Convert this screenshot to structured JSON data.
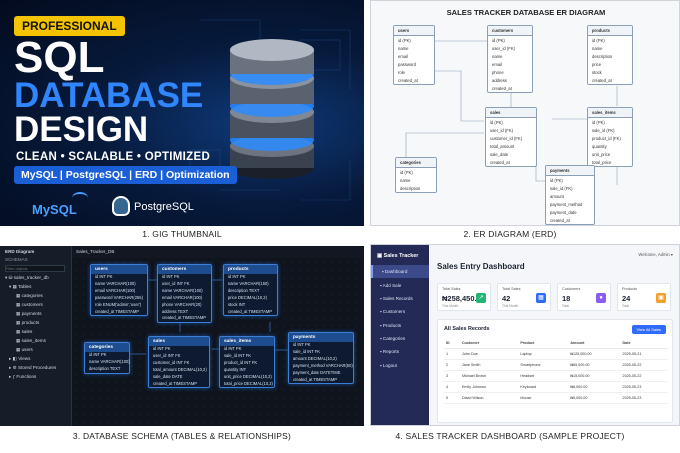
{
  "captions": [
    "1. GIG THUMBNAIL",
    "2. ER DIAGRAM (ERD)",
    "3. DATABASE SCHEMA (TABLES & RELATIONSHIPS)",
    "4. SALES TRACKER DASHBOARD (SAMPLE PROJECT)"
  ],
  "thumb": {
    "badge": "PROFESSIONAL",
    "line1": "SQL",
    "line2": "DATABASE",
    "line3": "DESIGN",
    "tagline": "CLEAN • SCALABLE • OPTIMIZED",
    "tech": "MySQL | PostgreSQL | ERD | Optimization",
    "mysql": "MySQL",
    "postgres": "PostgreSQL"
  },
  "erd": {
    "title": "SALES TRACKER DATABASE ER DIAGRAM",
    "users": {
      "name": "users",
      "fields": [
        "id (PK)",
        "name",
        "email",
        "password",
        "role",
        "created_at"
      ]
    },
    "customers": {
      "name": "customers",
      "fields": [
        "id (PK)",
        "user_id (FK)",
        "name",
        "email",
        "phone",
        "address",
        "created_at"
      ]
    },
    "products": {
      "name": "products",
      "fields": [
        "id (PK)",
        "name",
        "description",
        "price",
        "stock",
        "created_at"
      ]
    },
    "sales": {
      "name": "sales",
      "fields": [
        "id (PK)",
        "user_id (FK)",
        "customer_id (FK)",
        "total_amount",
        "sale_date",
        "created_at"
      ]
    },
    "sales_items": {
      "name": "sales_items",
      "fields": [
        "id (PK)",
        "sale_id (FK)",
        "product_id (FK)",
        "quantity",
        "unit_price",
        "total_price"
      ]
    },
    "categories": {
      "name": "categories",
      "fields": [
        "id (PK)",
        "name",
        "description"
      ]
    },
    "payments": {
      "name": "payments",
      "fields": [
        "id (PK)",
        "sale_id (FK)",
        "amount",
        "payment_method",
        "payment_date",
        "created_at"
      ]
    }
  },
  "schema": {
    "panel_title": "ERD Diagram",
    "tab": "Sales_Tracker_DB",
    "schemas_label": "SCHEMAS",
    "filter_placeholder": "Filter objects",
    "db": "sales_tracker_db",
    "tables_label": "Tables",
    "tree": [
      "categories",
      "customers",
      "payments",
      "products",
      "sales",
      "sales_items",
      "users"
    ],
    "views": "Views",
    "procs": "Stored Procedures",
    "funcs": "Functions",
    "users": {
      "name": "users",
      "fields": [
        "id INT PK",
        "name VARCHAR(100)",
        "email VARCHAR(100)",
        "password VARCHAR(255)",
        "role ENUM('admin','user')",
        "created_at TIMESTAMP"
      ]
    },
    "customers": {
      "name": "customers",
      "fields": [
        "id INT PK",
        "user_id INT FK",
        "name VARCHAR(100)",
        "email VARCHAR(100)",
        "phone VARCHAR(20)",
        "address TEXT",
        "created_at TIMESTAMP"
      ]
    },
    "products": {
      "name": "products",
      "fields": [
        "id INT PK",
        "name VARCHAR(150)",
        "description TEXT",
        "price DECIMAL(10,2)",
        "stock INT",
        "created_at TIMESTAMP"
      ]
    },
    "categories": {
      "name": "categories",
      "fields": [
        "id INT PK",
        "name VARCHAR(100)",
        "description TEXT"
      ]
    },
    "sales": {
      "name": "sales",
      "fields": [
        "id INT PK",
        "user_id INT FK",
        "customer_id INT FK",
        "total_amount DECIMAL(10,2)",
        "sale_date DATE",
        "created_at TIMESTAMP"
      ]
    },
    "sales_items": {
      "name": "sales_items",
      "fields": [
        "id INT PK",
        "sale_id INT FK",
        "product_id INT FK",
        "quantity INT",
        "unit_price DECIMAL(10,2)",
        "total_price DECIMAL(10,2)"
      ]
    },
    "payments": {
      "name": "payments",
      "fields": [
        "id INT PK",
        "sale_id INT FK",
        "amount DECIMAL(10,2)",
        "payment_method VARCHAR(50)",
        "payment_date DATETIME",
        "created_at TIMESTAMP"
      ]
    }
  },
  "dashboard": {
    "brand": "Sales Tracker",
    "welcome": "Welcome, Admin",
    "title": "Sales Entry Dashboard",
    "nav": [
      "Dashboard",
      "Add Sale",
      "Sales Records",
      "Customers",
      "Products",
      "Categories",
      "Reports",
      "Logout"
    ],
    "cards": [
      {
        "label": "Total Sales",
        "value": "₦258,450.00",
        "sub": "This Month",
        "color": "#22b573",
        "icon": "↗"
      },
      {
        "label": "Total Sales",
        "value": "42",
        "sub": "This Month",
        "color": "#2f6bff",
        "icon": "▦"
      },
      {
        "label": "Customers",
        "value": "18",
        "sub": "Total",
        "color": "#8a5cf6",
        "icon": "●"
      },
      {
        "label": "Products",
        "value": "24",
        "sub": "Total",
        "color": "#f59f2b",
        "icon": "▣"
      }
    ],
    "records_title": "All Sales Records",
    "view_all": "View All Sales",
    "columns": [
      "ID",
      "Customer",
      "Product",
      "Amount",
      "Date"
    ],
    "rows": [
      [
        "1",
        "John Doe",
        "Laptop",
        "₦120,000.00",
        "2025-05-21"
      ],
      [
        "2",
        "Jane Smith",
        "Smartphone",
        "₦65,000.00",
        "2025-05-22"
      ],
      [
        "3",
        "Michael Brown",
        "Headset",
        "₦15,000.00",
        "2025-05-22"
      ],
      [
        "4",
        "Emily Johnson",
        "Keyboard",
        "₦8,000.00",
        "2025-05-23"
      ],
      [
        "5",
        "David Wilson",
        "Mouse",
        "₦5,000.00",
        "2025-05-23"
      ]
    ]
  },
  "colors": {
    "accent": "#2f86ff",
    "badge": "#f5c400",
    "dash_sidebar": "#232a55",
    "primary_button": "#2f6bff"
  }
}
